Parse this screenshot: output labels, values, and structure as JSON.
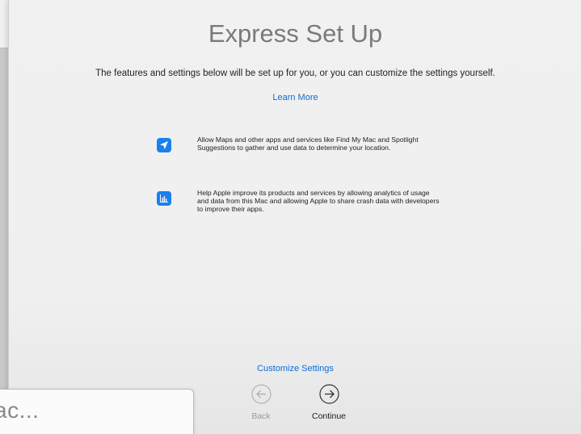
{
  "background_window": {
    "partial_text": "ac..."
  },
  "setup": {
    "title": "Express Set Up",
    "subtitle": "The features and settings below will be set up for you, or you can customize the settings yourself.",
    "learn_more": "Learn More",
    "features": [
      {
        "icon": "location-arrow-icon",
        "text": "Allow Maps and other apps and services like Find My Mac and Spotlight Suggestions to gather and use data to determine your location."
      },
      {
        "icon": "analytics-chart-icon",
        "text": "Help Apple improve its products and services by allowing analytics of usage and data from this Mac and allowing Apple to share crash data with developers to improve their apps."
      }
    ],
    "customize_settings": "Customize Settings",
    "back_label": "Back",
    "continue_label": "Continue"
  },
  "colors": {
    "accent": "#0a6dd9",
    "icon_bg": "#1a7ff0",
    "title": "#7a7a7a"
  }
}
